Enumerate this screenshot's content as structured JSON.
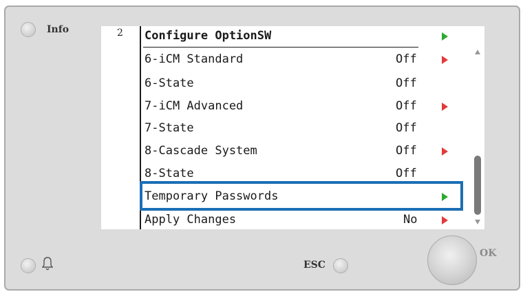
{
  "controls": {
    "info_label": "Info",
    "esc_label": "ESC",
    "ok_label": "OK"
  },
  "screen": {
    "page_number": "2",
    "title": "Configure OptionSW",
    "rows": [
      {
        "label": "6-iCM Standard",
        "value": "Off",
        "arrow": "red"
      },
      {
        "label": "6-State",
        "value": "Off",
        "arrow": ""
      },
      {
        "label": "7-iCM Advanced",
        "value": "Off",
        "arrow": "red"
      },
      {
        "label": "7-State",
        "value": "Off",
        "arrow": ""
      },
      {
        "label": "8-Cascade System",
        "value": "Off",
        "arrow": "red"
      },
      {
        "label": "8-State",
        "value": "Off",
        "arrow": ""
      },
      {
        "label": "Temporary Passwords",
        "value": "",
        "arrow": "green"
      },
      {
        "label": "Apply Changes",
        "value": "No",
        "arrow": "red"
      }
    ],
    "selected_row": "Temporary Passwords"
  },
  "colors": {
    "selection_border": "#1c6fb4",
    "arrow_green": "#2eaa2e",
    "arrow_red": "#e23b3b"
  },
  "icons": {
    "bell": "bell-icon",
    "nav_arrow": "triangle-right-icon"
  }
}
